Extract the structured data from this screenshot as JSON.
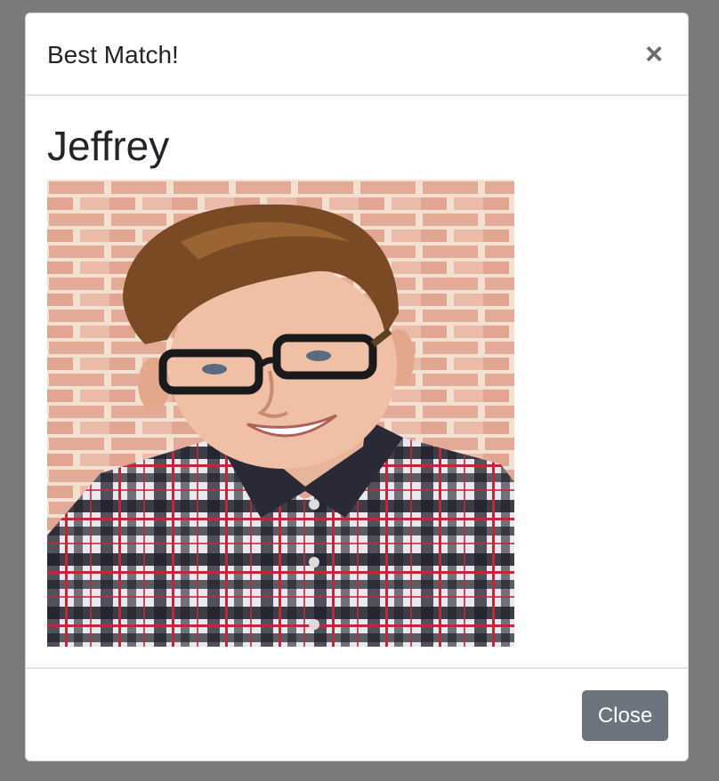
{
  "modal": {
    "title": "Best Match!",
    "close_icon": "×",
    "match_name": "Jeffrey",
    "photo_icon": "profile-photo",
    "footer": {
      "close_label": "Close"
    }
  },
  "colors": {
    "backdrop": "#7a7a7a",
    "close_button": "#6c757d",
    "divider": "#dee2e6",
    "text": "#212529"
  }
}
